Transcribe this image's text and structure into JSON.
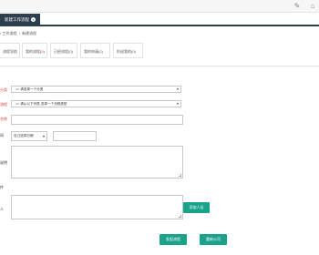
{
  "tabs": {
    "active_label": "新建工作流程",
    "close_glyph": "×"
  },
  "toolbar": {
    "edit_icon": "edit-icon",
    "home_icon": "home-icon"
  },
  "breadcrumb": {
    "part1": "工作流程",
    "separator": "›",
    "part2": "新建流程",
    "lead": "›"
  },
  "subtabs": [
    {
      "label": "流程导航"
    },
    {
      "label": "我的流程(",
      "count": "0",
      "close": ")"
    },
    {
      "label": "已经流程(",
      "count": "0",
      "close": ")"
    },
    {
      "label": "我的申请(",
      "count": "2",
      "close": ")"
    },
    {
      "label": "抄送我的(",
      "count": "0",
      "close": ")"
    }
  ],
  "form": {
    "category_label": "分类",
    "category_value": "== 请选择一个分类",
    "flow_label": "流程",
    "flow_value": "== 请从以下列表 选择一个流程类型",
    "name_label": "名称",
    "time_label": "间",
    "time_select_value": "自己选择日期",
    "desc_label": "说明",
    "attach_label": "件",
    "cc_label": "人",
    "add_person_label": "添加人员",
    "submit_label": "发起流程",
    "reset_label": "重新公司"
  }
}
